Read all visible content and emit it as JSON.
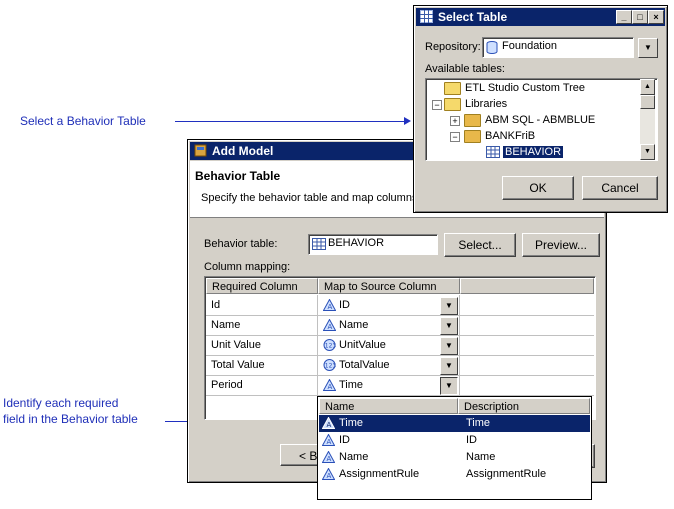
{
  "callouts": {
    "select_table": "Select a Behavior Table",
    "identify_line1": "Identify each required",
    "identify_line2": "field in the Behavior table"
  },
  "add_model": {
    "title": "Add Model",
    "heading": "Behavior Table",
    "description": "Specify the behavior table and map columns",
    "behavior_table_label": "Behavior table:",
    "behavior_table_value": "BEHAVIOR",
    "select_button": "Select...",
    "preview_button": "Preview...",
    "column_mapping_label": "Column mapping:",
    "columns": [
      "Required Column",
      "Map to Source Column"
    ],
    "rows": [
      {
        "required": "Id",
        "source": "ID",
        "icon": "attribute-icon"
      },
      {
        "required": "Name",
        "source": "Name",
        "icon": "attribute-icon"
      },
      {
        "required": "Unit Value",
        "source": "UnitValue",
        "icon": "numeric-icon"
      },
      {
        "required": "Total Value",
        "source": "TotalValue",
        "icon": "numeric-icon"
      },
      {
        "required": "Period",
        "source": "Time",
        "icon": "attribute-icon"
      }
    ],
    "back_button_partial": "< Ba"
  },
  "dropdown": {
    "columns": [
      "Name",
      "Description"
    ],
    "items": [
      {
        "name": "Time",
        "description": "Time",
        "selected": true
      },
      {
        "name": "ID",
        "description": "ID",
        "selected": false
      },
      {
        "name": "Name",
        "description": "Name",
        "selected": false
      },
      {
        "name": "AssignmentRule",
        "description": "AssignmentRule",
        "selected": false
      }
    ]
  },
  "select_table": {
    "title": "Select Table",
    "repository_label": "Repository:",
    "repository_value": "Foundation",
    "available_label": "Available tables:",
    "tree": {
      "etl": "ETL Studio Custom Tree",
      "libraries": "Libraries",
      "abm": "ABM SQL - ABMBLUE",
      "bank": "BANKFriB",
      "behavior": "BEHAVIOR"
    },
    "ok_button": "OK",
    "cancel_button": "Cancel"
  },
  "colors": {
    "accent": "#0a246a",
    "callout": "#1f2fb8",
    "dialog_bg": "#d4d0c8"
  }
}
